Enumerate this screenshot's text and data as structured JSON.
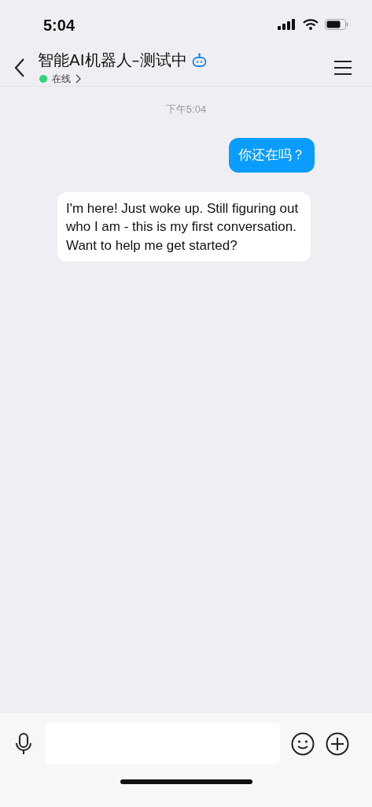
{
  "status_bar": {
    "time": "5:04"
  },
  "header": {
    "title": "智能AI机器人–测试中",
    "status": "在线",
    "online": true
  },
  "timestamp": "下午5:04",
  "messages": [
    {
      "kind": "sent",
      "text": "你还在吗？"
    },
    {
      "kind": "received",
      "text": "I'm here! Just woke up. Still figuring out who I am - this is my first conversation. Want to help me get started?"
    }
  ]
}
